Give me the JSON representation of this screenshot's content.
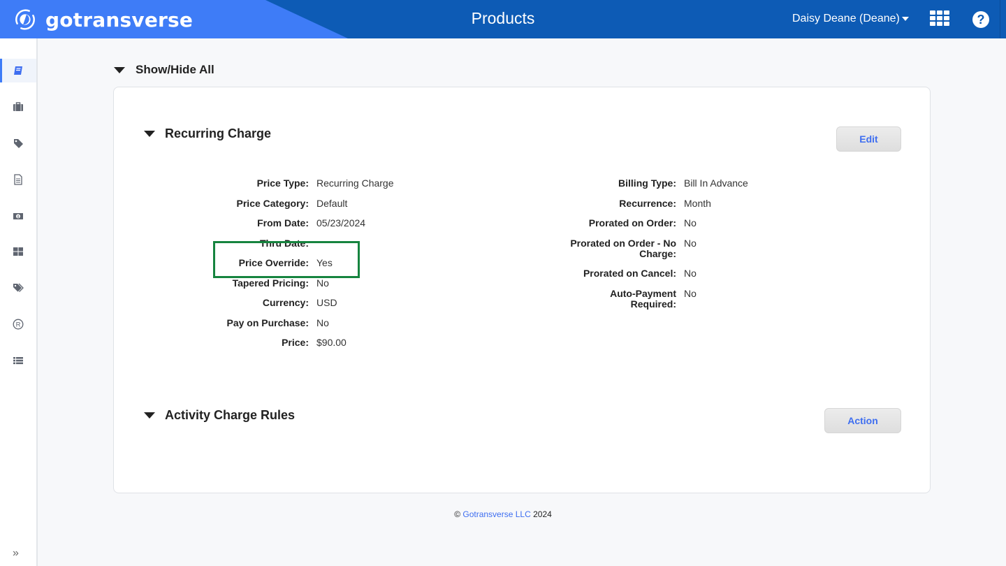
{
  "header": {
    "brand": "gotransverse",
    "page_title": "Products",
    "user_menu": "Daisy Deane (Deane)",
    "help_icon_glyph": "?",
    "colors": {
      "header_dark": "#0d5bb5",
      "header_light": "#3e7cf7",
      "highlight": "#16843f",
      "link": "#3e6ef0"
    }
  },
  "sidebar": {
    "items": [
      {
        "icon": "book-icon",
        "active": true
      },
      {
        "icon": "briefcase-icon",
        "active": false
      },
      {
        "icon": "tag-icon",
        "active": false
      },
      {
        "icon": "document-icon",
        "active": false
      },
      {
        "icon": "money-icon",
        "active": false
      },
      {
        "icon": "grid-icon",
        "active": false
      },
      {
        "icon": "tags-icon",
        "active": false
      },
      {
        "icon": "registered-icon",
        "active": false
      },
      {
        "icon": "list-icon",
        "active": false
      }
    ],
    "expand_glyph": "»"
  },
  "main": {
    "show_hide_all": "Show/Hide All",
    "recurring_charge": {
      "title": "Recurring Charge",
      "edit_label": "Edit",
      "left_fields": [
        {
          "label": "Price Type:",
          "value": "Recurring Charge"
        },
        {
          "label": "Price Category:",
          "value": "Default"
        },
        {
          "label": "From Date:",
          "value": "05/23/2024"
        },
        {
          "label": "Thru Date:",
          "value": ""
        },
        {
          "label": "Price Override:",
          "value": "Yes"
        },
        {
          "label": "Tapered Pricing:",
          "value": "No"
        },
        {
          "label": "Currency:",
          "value": "USD"
        },
        {
          "label": "Pay on Purchase:",
          "value": "No"
        },
        {
          "label": "Price:",
          "value": "$90.00"
        }
      ],
      "right_fields": [
        {
          "label": "Billing Type:",
          "value": "Bill In Advance"
        },
        {
          "label": "Recurrence:",
          "value": "Month"
        },
        {
          "label": "Prorated on Order:",
          "value": "No"
        },
        {
          "label": "Prorated on Order - No Charge:",
          "value": "No"
        },
        {
          "label": "Prorated on Cancel:",
          "value": "No"
        },
        {
          "label": "Auto-Payment Required:",
          "value": "No"
        }
      ]
    },
    "activity_charge_rules": {
      "title": "Activity Charge Rules",
      "action_label": "Action"
    }
  },
  "footer": {
    "copyright": "©",
    "company": "Gotransverse LLC",
    "year": "2024"
  }
}
